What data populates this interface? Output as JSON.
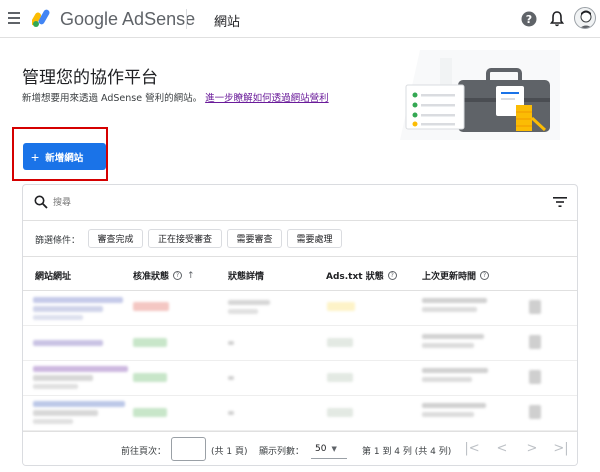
{
  "header": {
    "brand": "Google AdSense",
    "section": "網站",
    "icons": [
      "menu-icon",
      "adsense-logo-icon",
      "help-icon",
      "notifications-icon",
      "avatar"
    ]
  },
  "hero": {
    "title": "管理您的協作平台",
    "subtitle": "新增想要用來透過 AdSense 營利的網站。",
    "learn_more": "進一步瞭解如何透過網站營利"
  },
  "actions": {
    "add_site": "新增網站"
  },
  "search": {
    "placeholder": "搜尋"
  },
  "filters": {
    "label": "篩選條件：",
    "chips": [
      "審查完成",
      "正在接受審查",
      "需要審查",
      "需要處理"
    ]
  },
  "table": {
    "columns": [
      "網站網址",
      "核准狀態",
      "狀態詳情",
      "Ads.txt 狀態",
      "上次更新時間"
    ]
  },
  "pager": {
    "goto_label": "前往頁次：",
    "total_pages": "(共 1 頁)",
    "rows_label": "顯示列數：",
    "rows_value": "50",
    "range": "第 1 到 4 列 (共 4 列)"
  },
  "colors": {
    "primary": "#1a73e8",
    "highlight": "#d50000",
    "link": "#6a1b9a"
  }
}
